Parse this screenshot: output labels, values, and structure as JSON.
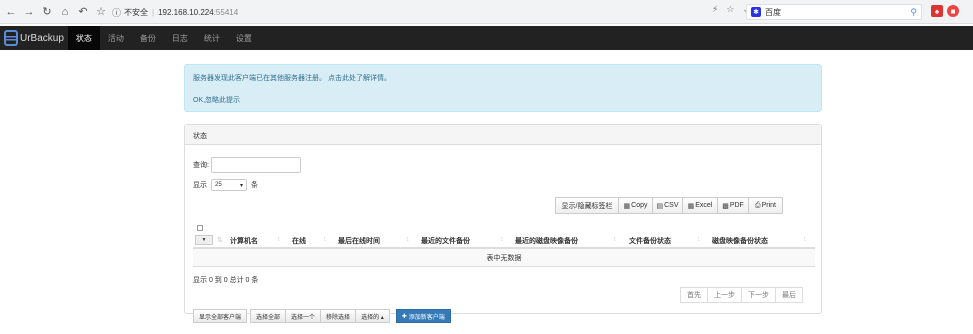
{
  "browser": {
    "nav_icons": [
      "back-icon",
      "forward-icon",
      "reload-icon",
      "home-icon",
      "undo-icon",
      "star-icon"
    ],
    "security_label": "不安全",
    "host": "192.168.10.224",
    "port": ":55414",
    "search_engine_label": "百度"
  },
  "navbar": {
    "brand": "UrBackup",
    "items": [
      {
        "label": "状态",
        "active": true
      },
      {
        "label": "活动"
      },
      {
        "label": "备份"
      },
      {
        "label": "日志"
      },
      {
        "label": "统计"
      },
      {
        "label": "设置"
      }
    ]
  },
  "alert": {
    "message": "服务器发现此客户端已在其他服务器注册。",
    "link": "点击此处了解详情。",
    "dismiss": "OK,忽略此提示"
  },
  "panel": {
    "title": "状态",
    "search_label": "查询:",
    "length_prefix": "显示",
    "length_value": "25",
    "length_suffix": "条",
    "buttons": {
      "show_hidden": "显示/隐藏标签栏",
      "copy": "Copy",
      "csv": "CSV",
      "excel": "Excel",
      "pdf": "PDF",
      "print": "Print"
    },
    "columns": [
      "计算机名",
      "在线",
      "最后在线时间",
      "最近的文件备份",
      "最近的磁盘映像备份",
      "文件备份状态",
      "磁盘映像备份状态"
    ],
    "empty_text": "表中无数据",
    "info_text": "显示 0 到 0 总计 0 条",
    "pager": {
      "first": "首先",
      "prev": "上一步",
      "next": "下一步",
      "last": "最后"
    },
    "actions": {
      "show_all": "显示全部客户端",
      "select_all": "选择全部",
      "select_one": "选择一个",
      "remove_sel": "移除选择",
      "selected": "选择的 ▴",
      "add_client": "添加新客户端"
    }
  }
}
